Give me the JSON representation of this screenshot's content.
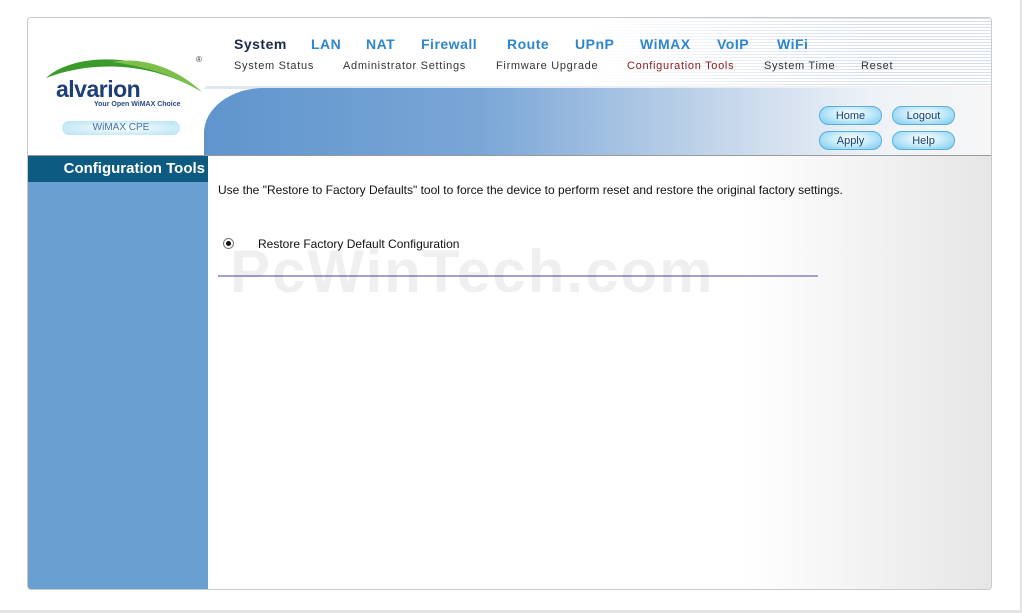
{
  "brand": {
    "name": "alvarion",
    "tagline": "Your Open WiMAX Choice",
    "product": "WiMAX CPE",
    "reg_mark": "®"
  },
  "nav": {
    "main": [
      {
        "label": "System",
        "active": true
      },
      {
        "label": "LAN"
      },
      {
        "label": "NAT"
      },
      {
        "label": "Firewall"
      },
      {
        "label": "Route"
      },
      {
        "label": "UPnP"
      },
      {
        "label": "WiMAX"
      },
      {
        "label": "VoIP"
      },
      {
        "label": "WiFi"
      }
    ],
    "sub": [
      {
        "label": "System Status"
      },
      {
        "label": "Administrator Settings"
      },
      {
        "label": "Firmware Upgrade"
      },
      {
        "label": "Configuration Tools",
        "active": true
      },
      {
        "label": "System Time"
      },
      {
        "label": "Reset"
      }
    ]
  },
  "buttons": {
    "home": "Home",
    "logout": "Logout",
    "apply": "Apply",
    "help": "Help"
  },
  "sidebar": {
    "title": "Configuration Tools"
  },
  "content": {
    "description": "Use the \"Restore to Factory Defaults\" tool to force the device to perform reset and restore the original factory settings.",
    "option_label": "Restore Factory Default Configuration",
    "option_selected": true
  },
  "watermark": "PcWinTech.com",
  "colors": {
    "nav_link": "#2f86c9",
    "nav_active": "#1b2a4a",
    "sub_active": "#8b1a1a",
    "sidebar_bg": "#6a9fd1",
    "sidebar_title_bg": "#0e5b82",
    "logo_green": "#3a9a2a",
    "logo_blue": "#1e3e78"
  },
  "icons": {
    "logo": "alvarion-swoosh-logo",
    "radio": "radio-button-selected"
  }
}
